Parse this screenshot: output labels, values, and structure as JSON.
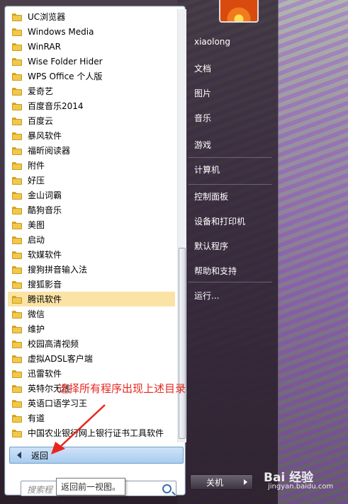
{
  "programs": [
    {
      "label": "UC浏览器"
    },
    {
      "label": "Windows Media"
    },
    {
      "label": "WinRAR"
    },
    {
      "label": "Wise Folder Hider"
    },
    {
      "label": "WPS Office 个人版"
    },
    {
      "label": "爱奇艺"
    },
    {
      "label": "百度音乐2014"
    },
    {
      "label": "百度云"
    },
    {
      "label": "暴风软件"
    },
    {
      "label": "福昕阅读器"
    },
    {
      "label": "附件"
    },
    {
      "label": "好压"
    },
    {
      "label": "金山词霸"
    },
    {
      "label": "酷狗音乐"
    },
    {
      "label": "美图"
    },
    {
      "label": "启动"
    },
    {
      "label": "软媒软件"
    },
    {
      "label": "搜狗拼音输入法"
    },
    {
      "label": "搜狐影音"
    },
    {
      "label": "腾讯软件",
      "highlighted": true
    },
    {
      "label": "微信"
    },
    {
      "label": "维护"
    },
    {
      "label": "校园高清视频"
    },
    {
      "label": "虚拟ADSL客户端"
    },
    {
      "label": "迅雷软件"
    },
    {
      "label": "英特尔无线"
    },
    {
      "label": "英语口语学习王"
    },
    {
      "label": "有道"
    },
    {
      "label": "中国农业银行网上银行证书工具软件"
    }
  ],
  "back_label": "返回",
  "tooltip": "返回前一视图。",
  "search": {
    "placeholder": "搜索程"
  },
  "annotation": "选择所有程序出现上述目录",
  "right_menu": {
    "username": "xiaolong",
    "items": [
      "文档",
      "图片",
      "音乐",
      "游戏",
      "计算机",
      "控制面板",
      "设备和打印机",
      "默认程序",
      "帮助和支持",
      "运行..."
    ]
  },
  "shutdown_label": "关机",
  "watermark": {
    "brand": "Bai 经验",
    "url": "jingyan.baidu.com"
  },
  "colors": {
    "highlight": "#fbe3a6",
    "annotation": "#e8261e",
    "back_button": "#a9cdf0"
  }
}
